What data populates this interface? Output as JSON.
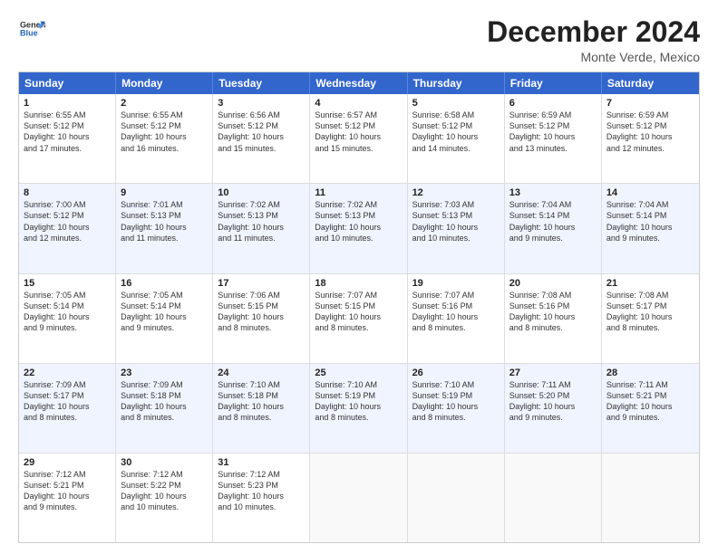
{
  "logo": {
    "general": "General",
    "blue": "Blue"
  },
  "header": {
    "month": "December 2024",
    "location": "Monte Verde, Mexico"
  },
  "weekdays": [
    "Sunday",
    "Monday",
    "Tuesday",
    "Wednesday",
    "Thursday",
    "Friday",
    "Saturday"
  ],
  "rows": [
    [
      {
        "day": "1",
        "text": "Sunrise: 6:55 AM\nSunset: 5:12 PM\nDaylight: 10 hours\nand 17 minutes."
      },
      {
        "day": "2",
        "text": "Sunrise: 6:55 AM\nSunset: 5:12 PM\nDaylight: 10 hours\nand 16 minutes."
      },
      {
        "day": "3",
        "text": "Sunrise: 6:56 AM\nSunset: 5:12 PM\nDaylight: 10 hours\nand 15 minutes."
      },
      {
        "day": "4",
        "text": "Sunrise: 6:57 AM\nSunset: 5:12 PM\nDaylight: 10 hours\nand 15 minutes."
      },
      {
        "day": "5",
        "text": "Sunrise: 6:58 AM\nSunset: 5:12 PM\nDaylight: 10 hours\nand 14 minutes."
      },
      {
        "day": "6",
        "text": "Sunrise: 6:59 AM\nSunset: 5:12 PM\nDaylight: 10 hours\nand 13 minutes."
      },
      {
        "day": "7",
        "text": "Sunrise: 6:59 AM\nSunset: 5:12 PM\nDaylight: 10 hours\nand 12 minutes."
      }
    ],
    [
      {
        "day": "8",
        "text": "Sunrise: 7:00 AM\nSunset: 5:12 PM\nDaylight: 10 hours\nand 12 minutes."
      },
      {
        "day": "9",
        "text": "Sunrise: 7:01 AM\nSunset: 5:13 PM\nDaylight: 10 hours\nand 11 minutes."
      },
      {
        "day": "10",
        "text": "Sunrise: 7:02 AM\nSunset: 5:13 PM\nDaylight: 10 hours\nand 11 minutes."
      },
      {
        "day": "11",
        "text": "Sunrise: 7:02 AM\nSunset: 5:13 PM\nDaylight: 10 hours\nand 10 minutes."
      },
      {
        "day": "12",
        "text": "Sunrise: 7:03 AM\nSunset: 5:13 PM\nDaylight: 10 hours\nand 10 minutes."
      },
      {
        "day": "13",
        "text": "Sunrise: 7:04 AM\nSunset: 5:14 PM\nDaylight: 10 hours\nand 9 minutes."
      },
      {
        "day": "14",
        "text": "Sunrise: 7:04 AM\nSunset: 5:14 PM\nDaylight: 10 hours\nand 9 minutes."
      }
    ],
    [
      {
        "day": "15",
        "text": "Sunrise: 7:05 AM\nSunset: 5:14 PM\nDaylight: 10 hours\nand 9 minutes."
      },
      {
        "day": "16",
        "text": "Sunrise: 7:05 AM\nSunset: 5:14 PM\nDaylight: 10 hours\nand 9 minutes."
      },
      {
        "day": "17",
        "text": "Sunrise: 7:06 AM\nSunset: 5:15 PM\nDaylight: 10 hours\nand 8 minutes."
      },
      {
        "day": "18",
        "text": "Sunrise: 7:07 AM\nSunset: 5:15 PM\nDaylight: 10 hours\nand 8 minutes."
      },
      {
        "day": "19",
        "text": "Sunrise: 7:07 AM\nSunset: 5:16 PM\nDaylight: 10 hours\nand 8 minutes."
      },
      {
        "day": "20",
        "text": "Sunrise: 7:08 AM\nSunset: 5:16 PM\nDaylight: 10 hours\nand 8 minutes."
      },
      {
        "day": "21",
        "text": "Sunrise: 7:08 AM\nSunset: 5:17 PM\nDaylight: 10 hours\nand 8 minutes."
      }
    ],
    [
      {
        "day": "22",
        "text": "Sunrise: 7:09 AM\nSunset: 5:17 PM\nDaylight: 10 hours\nand 8 minutes."
      },
      {
        "day": "23",
        "text": "Sunrise: 7:09 AM\nSunset: 5:18 PM\nDaylight: 10 hours\nand 8 minutes."
      },
      {
        "day": "24",
        "text": "Sunrise: 7:10 AM\nSunset: 5:18 PM\nDaylight: 10 hours\nand 8 minutes."
      },
      {
        "day": "25",
        "text": "Sunrise: 7:10 AM\nSunset: 5:19 PM\nDaylight: 10 hours\nand 8 minutes."
      },
      {
        "day": "26",
        "text": "Sunrise: 7:10 AM\nSunset: 5:19 PM\nDaylight: 10 hours\nand 8 minutes."
      },
      {
        "day": "27",
        "text": "Sunrise: 7:11 AM\nSunset: 5:20 PM\nDaylight: 10 hours\nand 9 minutes."
      },
      {
        "day": "28",
        "text": "Sunrise: 7:11 AM\nSunset: 5:21 PM\nDaylight: 10 hours\nand 9 minutes."
      }
    ],
    [
      {
        "day": "29",
        "text": "Sunrise: 7:12 AM\nSunset: 5:21 PM\nDaylight: 10 hours\nand 9 minutes."
      },
      {
        "day": "30",
        "text": "Sunrise: 7:12 AM\nSunset: 5:22 PM\nDaylight: 10 hours\nand 10 minutes."
      },
      {
        "day": "31",
        "text": "Sunrise: 7:12 AM\nSunset: 5:23 PM\nDaylight: 10 hours\nand 10 minutes."
      },
      {
        "day": "",
        "text": ""
      },
      {
        "day": "",
        "text": ""
      },
      {
        "day": "",
        "text": ""
      },
      {
        "day": "",
        "text": ""
      }
    ]
  ]
}
